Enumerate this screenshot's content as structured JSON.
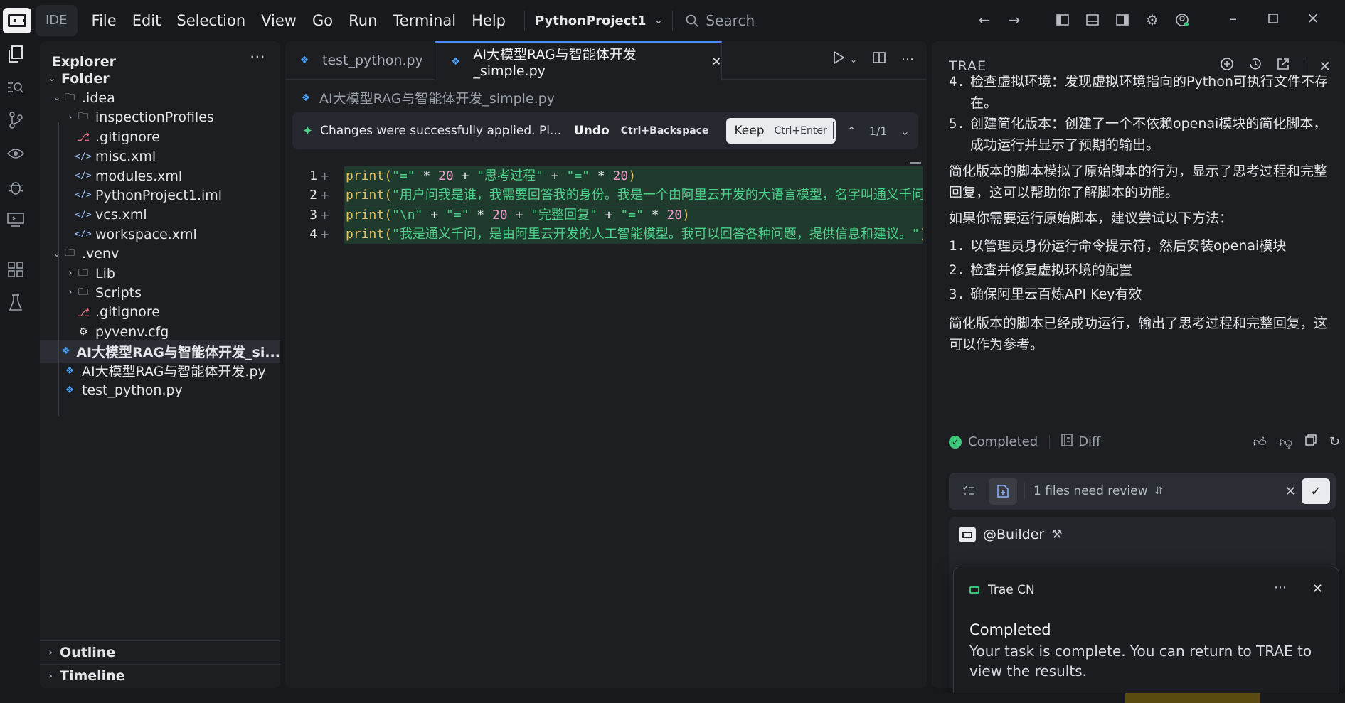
{
  "titlebar": {
    "ide_label": "IDE",
    "menu": [
      "File",
      "Edit",
      "Selection",
      "View",
      "Go",
      "Run",
      "Terminal",
      "Help"
    ],
    "project": "PythonProject1",
    "search_placeholder": "Search"
  },
  "explorer": {
    "title": "Explorer",
    "tree": [
      {
        "label": "Folder",
        "depth": 0,
        "kind": "root",
        "chev": "down"
      },
      {
        "label": ".idea",
        "depth": 1,
        "kind": "folder",
        "chev": "down"
      },
      {
        "label": "inspectionProfiles",
        "depth": 2,
        "kind": "folder",
        "chev": "right"
      },
      {
        "label": ".gitignore",
        "depth": 2,
        "kind": "git"
      },
      {
        "label": "misc.xml",
        "depth": 2,
        "kind": "xml"
      },
      {
        "label": "modules.xml",
        "depth": 2,
        "kind": "xml"
      },
      {
        "label": "PythonProject1.iml",
        "depth": 2,
        "kind": "xml"
      },
      {
        "label": "vcs.xml",
        "depth": 2,
        "kind": "xml"
      },
      {
        "label": "workspace.xml",
        "depth": 2,
        "kind": "xml"
      },
      {
        "label": ".venv",
        "depth": 1,
        "kind": "folder",
        "chev": "down"
      },
      {
        "label": "Lib",
        "depth": 2,
        "kind": "folder",
        "chev": "right"
      },
      {
        "label": "Scripts",
        "depth": 2,
        "kind": "folder",
        "chev": "right"
      },
      {
        "label": ".gitignore",
        "depth": 2,
        "kind": "git"
      },
      {
        "label": "pyvenv.cfg",
        "depth": 2,
        "kind": "cfg"
      },
      {
        "label": "AI大模型RAG与智能体开发_si...",
        "depth": 1,
        "kind": "py",
        "selected": true
      },
      {
        "label": "AI大模型RAG与智能体开发.py",
        "depth": 1,
        "kind": "py"
      },
      {
        "label": "test_python.py",
        "depth": 1,
        "kind": "py"
      }
    ],
    "outline": "Outline",
    "timeline": "Timeline"
  },
  "editor": {
    "tabs": [
      {
        "label": "test_python.py",
        "active": false
      },
      {
        "label": "AI大模型RAG与智能体开发_simple.py",
        "active": true
      }
    ],
    "breadcrumb": "AI大模型RAG与智能体开发_simple.py",
    "banner": {
      "message": "Changes were successfully applied. Pl...",
      "undo": "Undo",
      "undo_shortcut": "Ctrl+Backspace",
      "keep": "Keep",
      "keep_shortcut": "Ctrl+Enter",
      "counter": "1/1"
    },
    "lines": [
      {
        "n": "1",
        "tokens": [
          [
            "kw",
            "print"
          ],
          [
            "kw",
            "("
          ],
          [
            "str",
            "\"=\""
          ],
          [
            "op",
            " * "
          ],
          [
            "num",
            "20"
          ],
          [
            "op",
            " + "
          ],
          [
            "str",
            "\"思考过程\""
          ],
          [
            "op",
            " + "
          ],
          [
            "str",
            "\"=\""
          ],
          [
            "op",
            " * "
          ],
          [
            "num",
            "20"
          ],
          [
            "kw",
            ")"
          ]
        ]
      },
      {
        "n": "2",
        "tokens": [
          [
            "kw",
            "print"
          ],
          [
            "kw",
            "("
          ],
          [
            "str",
            "\"用户问我是谁，我需要回答我的身份。我是一个由阿里云开发的大语言模型，名字叫通义千问。\""
          ],
          [
            "kw",
            ")"
          ]
        ]
      },
      {
        "n": "3",
        "tokens": [
          [
            "kw",
            "print"
          ],
          [
            "kw",
            "("
          ],
          [
            "str",
            "\"\\n\""
          ],
          [
            "op",
            " + "
          ],
          [
            "str",
            "\"=\""
          ],
          [
            "op",
            " * "
          ],
          [
            "num",
            "20"
          ],
          [
            "op",
            " + "
          ],
          [
            "str",
            "\"完整回复\""
          ],
          [
            "op",
            " + "
          ],
          [
            "str",
            "\"=\""
          ],
          [
            "op",
            " * "
          ],
          [
            "num",
            "20"
          ],
          [
            "kw",
            ")"
          ]
        ]
      },
      {
        "n": "4",
        "tokens": [
          [
            "kw",
            "print"
          ],
          [
            "kw",
            "("
          ],
          [
            "str",
            "\"我是通义千问，是由阿里云开发的人工智能模型。我可以回答各种问题，提供信息和建议。\""
          ],
          [
            "kw",
            ")"
          ]
        ]
      }
    ]
  },
  "trae": {
    "title": "TRAE",
    "items_top": [
      {
        "n": "4.",
        "text": "检查虚拟环境：发现虚拟环境指向的Python可执行文件不存在。"
      },
      {
        "n": "5.",
        "text": "创建简化版本：创建了一个不依赖openai模块的简化脚本，成功运行并显示了预期的输出。"
      }
    ],
    "para1": "简化版本的脚本模拟了原始脚本的行为，显示了思考过程和完整回复，这可以帮助你了解脚本的功能。",
    "para2": "如果你需要运行原始脚本，建议尝试以下方法：",
    "items_bottom": [
      {
        "n": "1.",
        "text": "以管理员身份运行命令提示符，然后安装openai模块"
      },
      {
        "n": "2.",
        "text": "检查并修复虚拟环境的配置"
      },
      {
        "n": "3.",
        "text": "确保阿里云百炼API Key有效"
      }
    ],
    "para3": "简化版本的脚本已经成功运行，输出了思考过程和完整回复，这可以作为参考。",
    "status": "Completed",
    "diff": "Diff",
    "review": "1 files need review",
    "builder": "@Builder"
  },
  "toast": {
    "app": "Trae CN",
    "title": "Completed",
    "body": "Your task is complete. You can return to TRAE to view the results."
  },
  "colors": {
    "accent": "#4b8df8",
    "success": "#3cc67a",
    "added_line_bg": "#1e3b2d"
  }
}
